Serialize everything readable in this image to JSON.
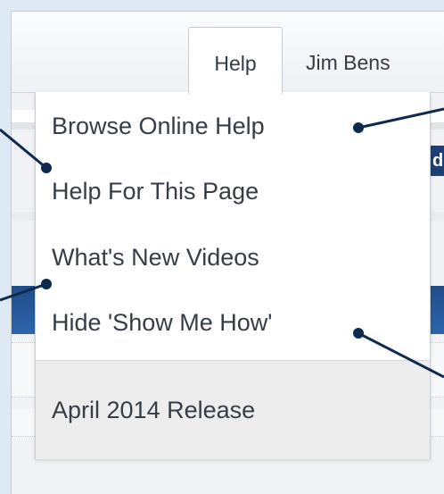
{
  "nav": {
    "tabs": [
      {
        "label": "Help",
        "active": true
      },
      {
        "label": "Jim Bens",
        "active": false
      }
    ]
  },
  "help_menu": {
    "items": [
      {
        "label": "Browse Online Help"
      },
      {
        "label": "Help For This Page"
      },
      {
        "label": "What's New Videos"
      },
      {
        "label": "Hide 'Show Me How'"
      }
    ],
    "footer": {
      "label": "April 2014 Release"
    }
  },
  "background": {
    "partial_text": "d"
  },
  "colors": {
    "accent": "#1f4d87",
    "callout": "#0f2a4f",
    "menu_text": "#353d48",
    "footer_bg": "#ededed"
  }
}
